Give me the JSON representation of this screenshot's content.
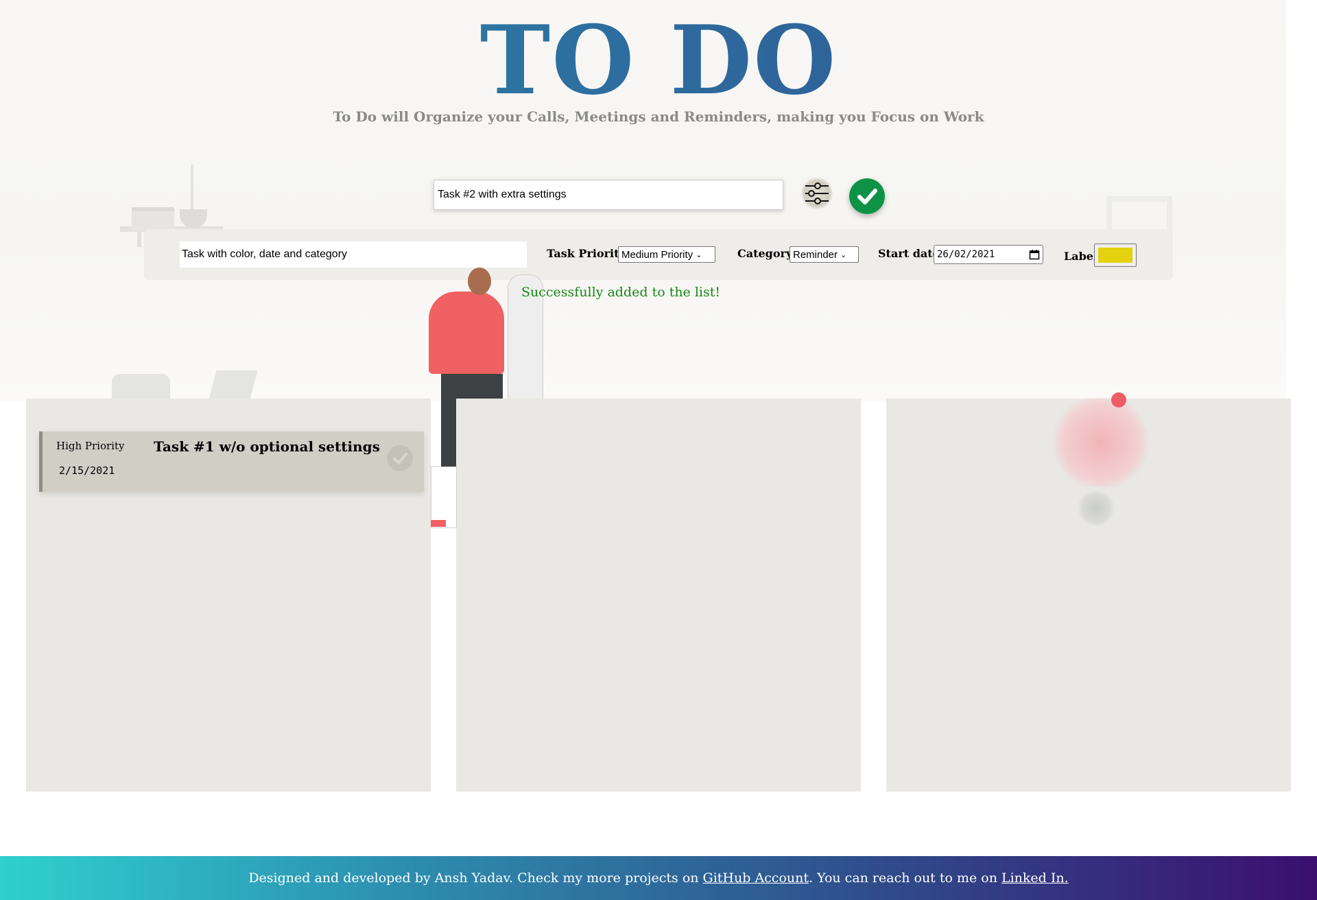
{
  "header": {
    "title": "TO DO",
    "subtitle": "To Do will Organize your Calls, Meetings and Reminders, making you Focus on Work"
  },
  "task_input": {
    "value": "Task #2 with extra settings"
  },
  "icons": {
    "settings": "sliders-icon",
    "submit": "checkmark-icon"
  },
  "settings_panel": {
    "extra_input_value": "Task with color, date and category",
    "priority_label": "Task Priority:",
    "priority_value": "Medium Priority",
    "category_label": "Category:",
    "category_value": "Reminder",
    "start_date_label": "Start date:",
    "start_date_value": "26/02/2021",
    "color_label": "Label",
    "label_color": "#e3d20d"
  },
  "status": {
    "message": "Successfully added to the list!"
  },
  "tasks": [
    {
      "priority": "High Priority",
      "date": "2/15/2021",
      "title": "Task #1 w/o optional settings"
    }
  ],
  "footer": {
    "text_before": "Designed and developed by Ansh Yadav. Check my more projects on ",
    "github_link": "GitHub Account",
    "text_middle": ". You can reach out to me on ",
    "linkedin_link": "Linked In."
  },
  "colors": {
    "accent_green": "#0e9346",
    "success_text": "#178517",
    "card_bg": "#d1cec6",
    "column_bg": "#e9e8e4"
  }
}
